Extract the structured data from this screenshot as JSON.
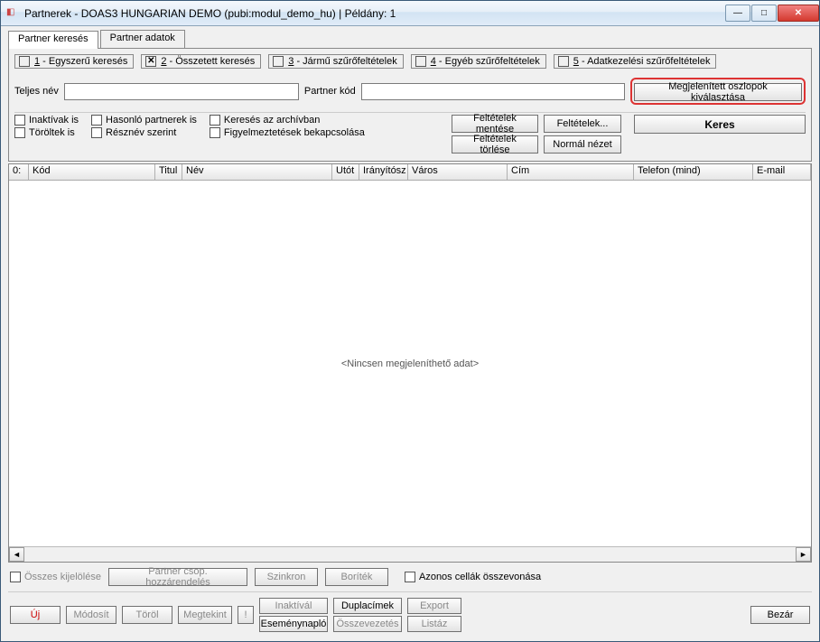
{
  "window": {
    "title": "Partnerek - DOAS3 HUNGARIAN DEMO (pubi:modul_demo_hu) | Példány: 1"
  },
  "tabs": {
    "search": "Partner keresés",
    "data": "Partner adatok"
  },
  "subtabs": {
    "t1_num": "1",
    "t1": " - Egyszerű keresés",
    "t2_num": "2",
    "t2": " - Összetett keresés",
    "t3_num": "3",
    "t3": " - Jármű szűrőfeltételek",
    "t4_num": "4",
    "t4": " - Egyéb szűrőfeltételek",
    "t5_num": "5",
    "t5": " - Adatkezelési szűrőfeltételek"
  },
  "labels": {
    "fullname": "Teljes név",
    "partnercode": "Partner kód",
    "cols_select": "Megjelenített oszlopok kiválasztása"
  },
  "checks": {
    "inactive": "Inaktívak is",
    "deleted": "Töröltek is",
    "similar": "Hasonló partnerek is",
    "partname": "Résznév szerint",
    "archive": "Keresés az archívban",
    "warnings": "Figyelmeztetések bekapcsolása"
  },
  "buttons": {
    "save_cond": "Feltételek mentése",
    "del_cond": "Feltételek törlése",
    "cond": "Feltételek...",
    "normal": "Normál nézet",
    "search": "Keres",
    "select_all": "Összes kijelölése",
    "group_assign": "Partner csop. hozzárendelés",
    "sync": "Szinkron",
    "envelope": "Boríték",
    "merge_cells": "Azonos cellák összevonása",
    "new": "Új",
    "modify": "Módosít",
    "delete": "Töröl",
    "view": "Megtekint",
    "bang": "!",
    "inactivate": "Inaktívál",
    "eventlog": "Eseménynapló",
    "dup": "Duplacímek",
    "merge": "Összevezetés",
    "export": "Export",
    "list": "Listáz",
    "close": "Bezár"
  },
  "grid": {
    "h0": "0:",
    "h1": "Kód",
    "h2": "Titul",
    "h3": "Név",
    "h4": "Utót",
    "h5": "Irányítósz",
    "h6": "Város",
    "h7": "Cím",
    "h8": "Telefon (mind)",
    "h9": "E-mail",
    "empty": "<Nincsen megjeleníthető adat>"
  }
}
